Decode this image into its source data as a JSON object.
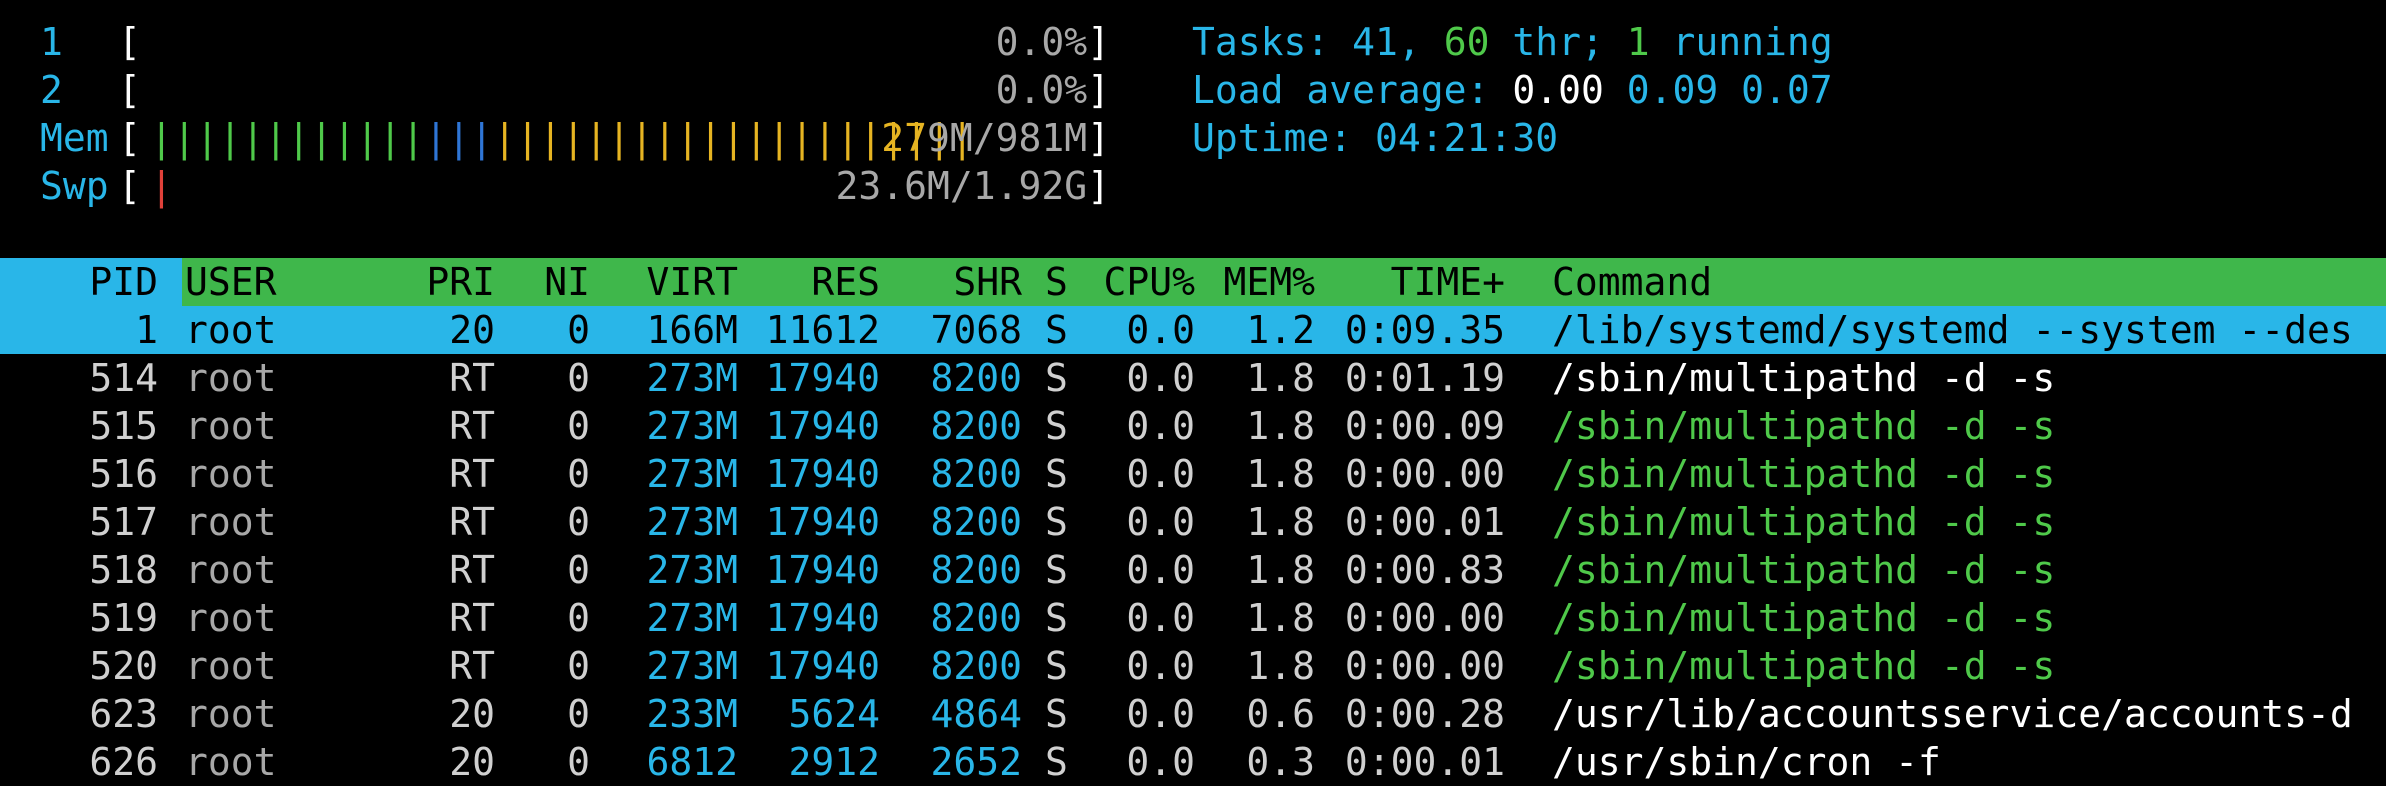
{
  "meters": [
    {
      "label": "1",
      "bars": "",
      "value": "0.0%"
    },
    {
      "label": "2",
      "bars": "",
      "value": "0.0%"
    },
    {
      "label": "Mem",
      "bars_green": "||||||||||||",
      "bars_blue": "|||",
      "bars_yellow": "|||||||||||||||||||||",
      "value_hi": "27",
      "value": "9M/981M"
    },
    {
      "label": "Swp",
      "bars_red": "|",
      "value": "23.6M/1.92G"
    }
  ],
  "summary": {
    "tasks_label": "Tasks:",
    "tasks": "41,",
    "threads": "60",
    "thr_label": "thr;",
    "running": "1",
    "running_label": "running",
    "load_label": "Load average:",
    "load1": "0.00",
    "load5": "0.09",
    "load15": "0.07",
    "uptime_label": "Uptime:",
    "uptime": "04:21:30"
  },
  "columns": {
    "pid": "PID",
    "user": "USER",
    "pri": "PRI",
    "ni": "NI",
    "virt": "VIRT",
    "res": "RES",
    "shr": "SHR",
    "s": "S",
    "cpu": "CPU%",
    "mem": "MEM%",
    "time": "TIME+",
    "cmd": "Command"
  },
  "processes": [
    {
      "pid": "1",
      "user": "root",
      "pri": "20",
      "ni": "0",
      "virt": "166M",
      "res": "11612",
      "shr": "7068",
      "s": "S",
      "cpu": "0.0",
      "mem": "1.2",
      "time": "0:09.35",
      "cmd": "/lib/systemd/systemd --system --des"
    },
    {
      "pid": "514",
      "user": "root",
      "pri": "RT",
      "ni": "0",
      "virt": "273M",
      "res": "17940",
      "shr": "8200",
      "s": "S",
      "cpu": "0.0",
      "mem": "1.8",
      "time": "0:01.19",
      "cmd": "/sbin/multipathd -d -s"
    },
    {
      "pid": "515",
      "user": "root",
      "pri": "RT",
      "ni": "0",
      "virt": "273M",
      "res": "17940",
      "shr": "8200",
      "s": "S",
      "cpu": "0.0",
      "mem": "1.8",
      "time": "0:00.09",
      "cmd": "/sbin/multipathd -d -s"
    },
    {
      "pid": "516",
      "user": "root",
      "pri": "RT",
      "ni": "0",
      "virt": "273M",
      "res": "17940",
      "shr": "8200",
      "s": "S",
      "cpu": "0.0",
      "mem": "1.8",
      "time": "0:00.00",
      "cmd": "/sbin/multipathd -d -s"
    },
    {
      "pid": "517",
      "user": "root",
      "pri": "RT",
      "ni": "0",
      "virt": "273M",
      "res": "17940",
      "shr": "8200",
      "s": "S",
      "cpu": "0.0",
      "mem": "1.8",
      "time": "0:00.01",
      "cmd": "/sbin/multipathd -d -s"
    },
    {
      "pid": "518",
      "user": "root",
      "pri": "RT",
      "ni": "0",
      "virt": "273M",
      "res": "17940",
      "shr": "8200",
      "s": "S",
      "cpu": "0.0",
      "mem": "1.8",
      "time": "0:00.83",
      "cmd": "/sbin/multipathd -d -s"
    },
    {
      "pid": "519",
      "user": "root",
      "pri": "RT",
      "ni": "0",
      "virt": "273M",
      "res": "17940",
      "shr": "8200",
      "s": "S",
      "cpu": "0.0",
      "mem": "1.8",
      "time": "0:00.00",
      "cmd": "/sbin/multipathd -d -s"
    },
    {
      "pid": "520",
      "user": "root",
      "pri": "RT",
      "ni": "0",
      "virt": "273M",
      "res": "17940",
      "shr": "8200",
      "s": "S",
      "cpu": "0.0",
      "mem": "1.8",
      "time": "0:00.00",
      "cmd": "/sbin/multipathd -d -s"
    },
    {
      "pid": "623",
      "user": "root",
      "pri": "20",
      "ni": "0",
      "virt": "233M",
      "res": "5624",
      "shr": "4864",
      "s": "S",
      "cpu": "0.0",
      "mem": "0.6",
      "time": "0:00.28",
      "cmd": "/usr/lib/accountsservice/accounts-d"
    },
    {
      "pid": "626",
      "user": "root",
      "pri": "20",
      "ni": "0",
      "virt": "6812",
      "res": "2912",
      "shr": "2652",
      "s": "S",
      "cpu": "0.0",
      "mem": "0.3",
      "time": "0:00.01",
      "cmd": "/usr/sbin/cron -f"
    }
  ],
  "colors": {
    "accent": "#29b6e8",
    "header_user": "#3fb74b",
    "thread_cmd": "#4fc94a"
  }
}
